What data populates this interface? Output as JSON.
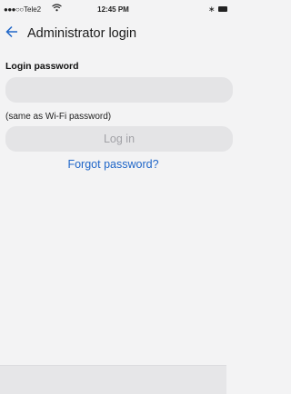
{
  "status_bar": {
    "signal": "●●●○○",
    "carrier": "Tele2",
    "time": "12:45 PM",
    "bluetooth": "∗"
  },
  "nav": {
    "title": "Administrator login"
  },
  "form": {
    "password_label": "Login password",
    "password_value": "",
    "hint": "(same as Wi-Fi password)",
    "login_label": "Log in",
    "forgot_label": "Forgot password?"
  },
  "colors": {
    "link": "#1f66c8",
    "field_background": "#e4e4e6",
    "disabled_text": "#a2a2a7"
  },
  "icons": {
    "back": "left-arrow-icon",
    "wifi": "wifi-icon",
    "bluetooth": "bluetooth-icon",
    "battery": "battery-icon"
  }
}
